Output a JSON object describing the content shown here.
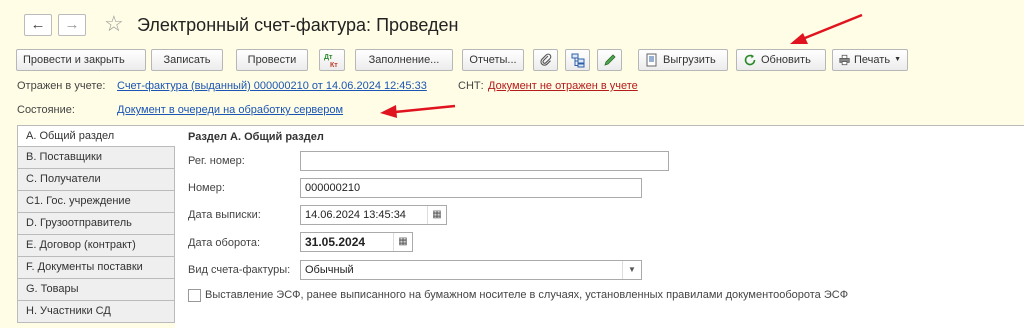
{
  "window": {
    "title": "Электронный счет-фактура: Проведен"
  },
  "nav": {
    "back_glyph": "←",
    "forward_glyph": "→"
  },
  "toolbar": {
    "post_close": "Провести и закрыть",
    "save": "Записать",
    "post": "Провести",
    "filling": "Заполнение...",
    "reports": "Отчеты...",
    "export": "Выгрузить",
    "refresh": "Обновить",
    "print": "Печать"
  },
  "info": {
    "reflected_label": "Отражен в учете:",
    "reflected_link": "Счет-фактура (выданный) 000000210 от 14.06.2024 12:45:33",
    "snt_label": "СНТ:",
    "snt_link": "Документ не отражен в учете",
    "state_label": "Состояние:",
    "state_link": "Документ в очереди на обработку сервером"
  },
  "tabs": [
    "A. Общий раздел",
    "B. Поставщики",
    "C. Получатели",
    "C1. Гос. учреждение",
    "D. Грузоотправитель",
    "E. Договор (контракт)",
    "F. Документы поставки",
    "G. Товары",
    "H. Участники СД"
  ],
  "form": {
    "section_title": "Раздел А. Общий раздел",
    "reg_number_label": "Рег. номер:",
    "reg_number_value": "",
    "number_label": "Номер:",
    "number_value": "000000210",
    "issue_date_label": "Дата выписки:",
    "issue_date_value": "14.06.2024 13:45:34",
    "turnover_date_label": "Дата оборота:",
    "turnover_date_value": "31.05.2024",
    "invoice_type_label": "Вид счета-фактуры:",
    "invoice_type_value": "Обычный",
    "esf_checkbox_label": "Выставление ЭСФ, ранее выписанного на бумажном носителе в случаях, установленных правилами документооборота ЭСФ",
    "esf_checked": false
  },
  "colors": {
    "accent_arrow": "#e0141e",
    "link": "#1b55b5",
    "link_red": "#b51b1b",
    "background": "#fffde6"
  }
}
